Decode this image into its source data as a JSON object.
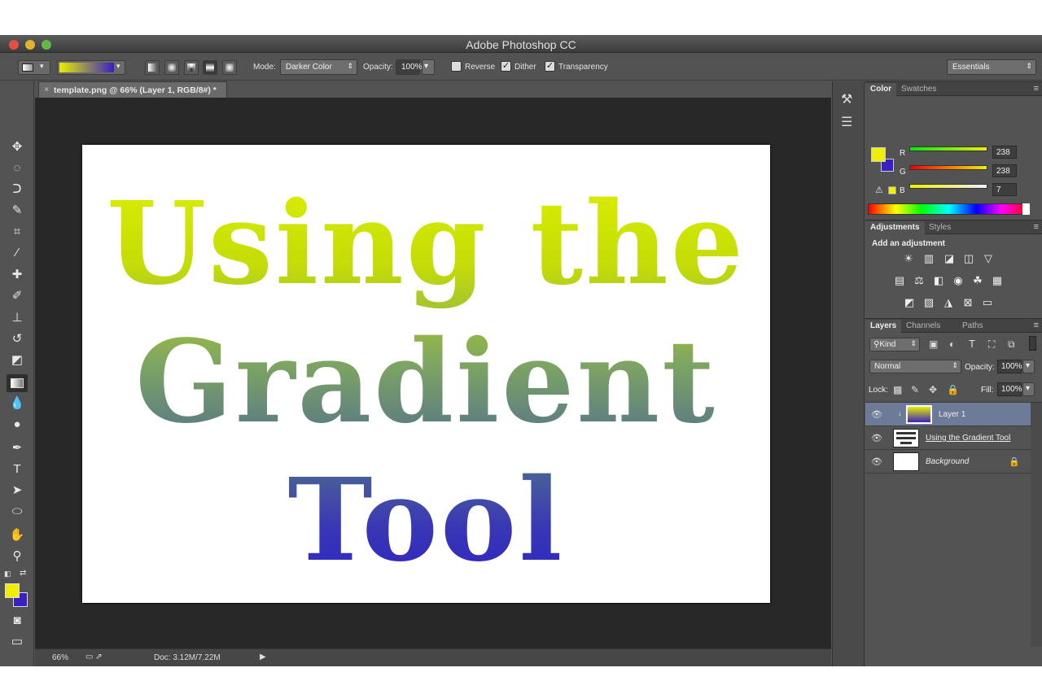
{
  "window": {
    "title": "Adobe Photoshop CC"
  },
  "options_bar": {
    "mode_label": "Mode:",
    "mode_value": "Darker Color",
    "opacity_label": "Opacity:",
    "opacity_value": "100%",
    "reverse_label": "Reverse",
    "dither_label": "Dither",
    "transparency_label": "Transparency",
    "workspace": "Essentials"
  },
  "document": {
    "tab_title": "template.png @ 66% (Layer 1, RGB/8#) *",
    "text_lines": [
      "Using the",
      "Gradient",
      "Tool"
    ]
  },
  "status": {
    "zoom": "66%",
    "doc_info": "Doc: 3.12M/7.22M"
  },
  "color_panel": {
    "tabs": [
      "Color",
      "Swatches"
    ],
    "r_label": "R",
    "g_label": "G",
    "b_label": "B",
    "r_value": "238",
    "g_value": "238",
    "b_value": "7",
    "foreground": "#eeee07",
    "background": "#3a1fc2"
  },
  "adjustments_panel": {
    "tabs": [
      "Adjustments",
      "Styles"
    ],
    "heading": "Add an adjustment"
  },
  "layers_panel": {
    "tabs": [
      "Layers",
      "Channels",
      "Paths"
    ],
    "kind_label": "Kind",
    "blend_mode": "Normal",
    "opacity_label": "Opacity:",
    "opacity_value": "100%",
    "lock_label": "Lock:",
    "fill_label": "Fill:",
    "fill_value": "100%",
    "layers": [
      {
        "name": "Layer 1"
      },
      {
        "name": "Using the Gradient Tool"
      },
      {
        "name": "Background"
      }
    ]
  }
}
